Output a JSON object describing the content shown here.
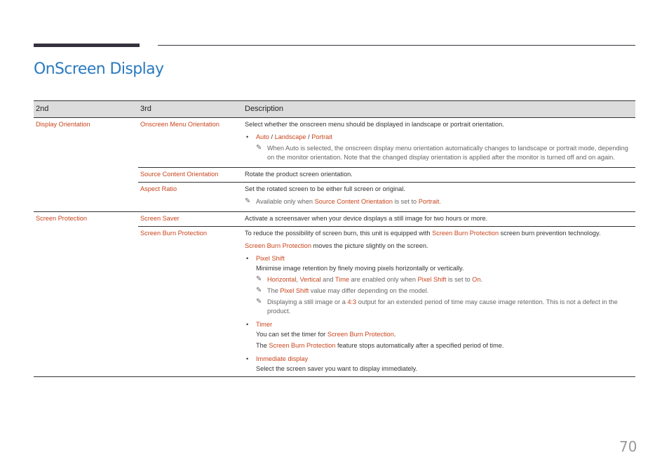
{
  "page": {
    "title": "OnScreen Display",
    "page_number": "70",
    "accent_color": "#2a7ac0",
    "highlight_color": "#c8451d"
  },
  "table": {
    "headers": [
      "2nd",
      "3rd",
      "Description"
    ],
    "display_orientation": {
      "label": "Display Orientation",
      "onscreen_menu_orientation": {
        "label": "Onscreen Menu Orientation",
        "desc": "Select whether the onscreen menu should be displayed in landscape or portrait orientation.",
        "options": [
          "Auto",
          "Landscape",
          "Portrait"
        ],
        "sep": " / ",
        "note": "When Auto is selected, the onscreen display menu orientation automatically changes to landscape or portrait mode, depending on the monitor orientation. Note that the changed display orientation is applied after the monitor is turned off and on again."
      },
      "source_content_orientation": {
        "label": "Source Content Orientation",
        "desc": "Rotate the product screen orientation."
      },
      "aspect_ratio": {
        "label": "Aspect Ratio",
        "desc": "Set the rotated screen to be either full screen or original.",
        "note_a": "Available only when ",
        "note_b": "Source Content Orientation",
        "note_c": " is set to ",
        "note_d": "Portrait",
        "note_e": "."
      }
    },
    "screen_protection": {
      "label": "Screen Protection",
      "screen_saver": {
        "label": "Screen Saver",
        "desc": "Activate a screensaver when your device displays a still image for two hours or more."
      },
      "screen_burn_protection": {
        "label": "Screen Burn Protection",
        "desc1_a": "To reduce the possibility of screen burn, this unit is equipped with ",
        "desc1_b": "Screen Burn Protection",
        "desc1_c": " screen burn prevention technology.",
        "desc2_a": "Screen Burn Protection",
        "desc2_b": " moves the picture slightly on the screen.",
        "pixel_shift": {
          "label": "Pixel Shift",
          "desc": "Minimise image retention by finely moving pixels horizontally or vertically.",
          "note1": [
            "Horizontal",
            ", ",
            "Vertical",
            " and ",
            "Time",
            " are enabled only when ",
            "Pixel Shift",
            " is set to ",
            "On",
            "."
          ],
          "note2": [
            "The ",
            "Pixel Shift",
            " value may differ depending on the model."
          ],
          "note3": [
            "Displaying a still image or a ",
            "4:3",
            " output for an extended period of time may cause image retention. This is not a defect in the product."
          ]
        },
        "timer": {
          "label": "Timer",
          "desc1_a": "You can set the timer for ",
          "desc1_b": "Screen Burn Protection",
          "desc1_c": ".",
          "desc2_a": "The ",
          "desc2_b": "Screen Burn Protection",
          "desc2_c": " feature stops automatically after a specified period of time."
        },
        "immediate_display": {
          "label": "Immediate display",
          "desc": "Select the screen saver you want to display immediately."
        }
      }
    }
  },
  "icons": {
    "note": "pencil-icon",
    "bullet": "bullet-icon"
  }
}
